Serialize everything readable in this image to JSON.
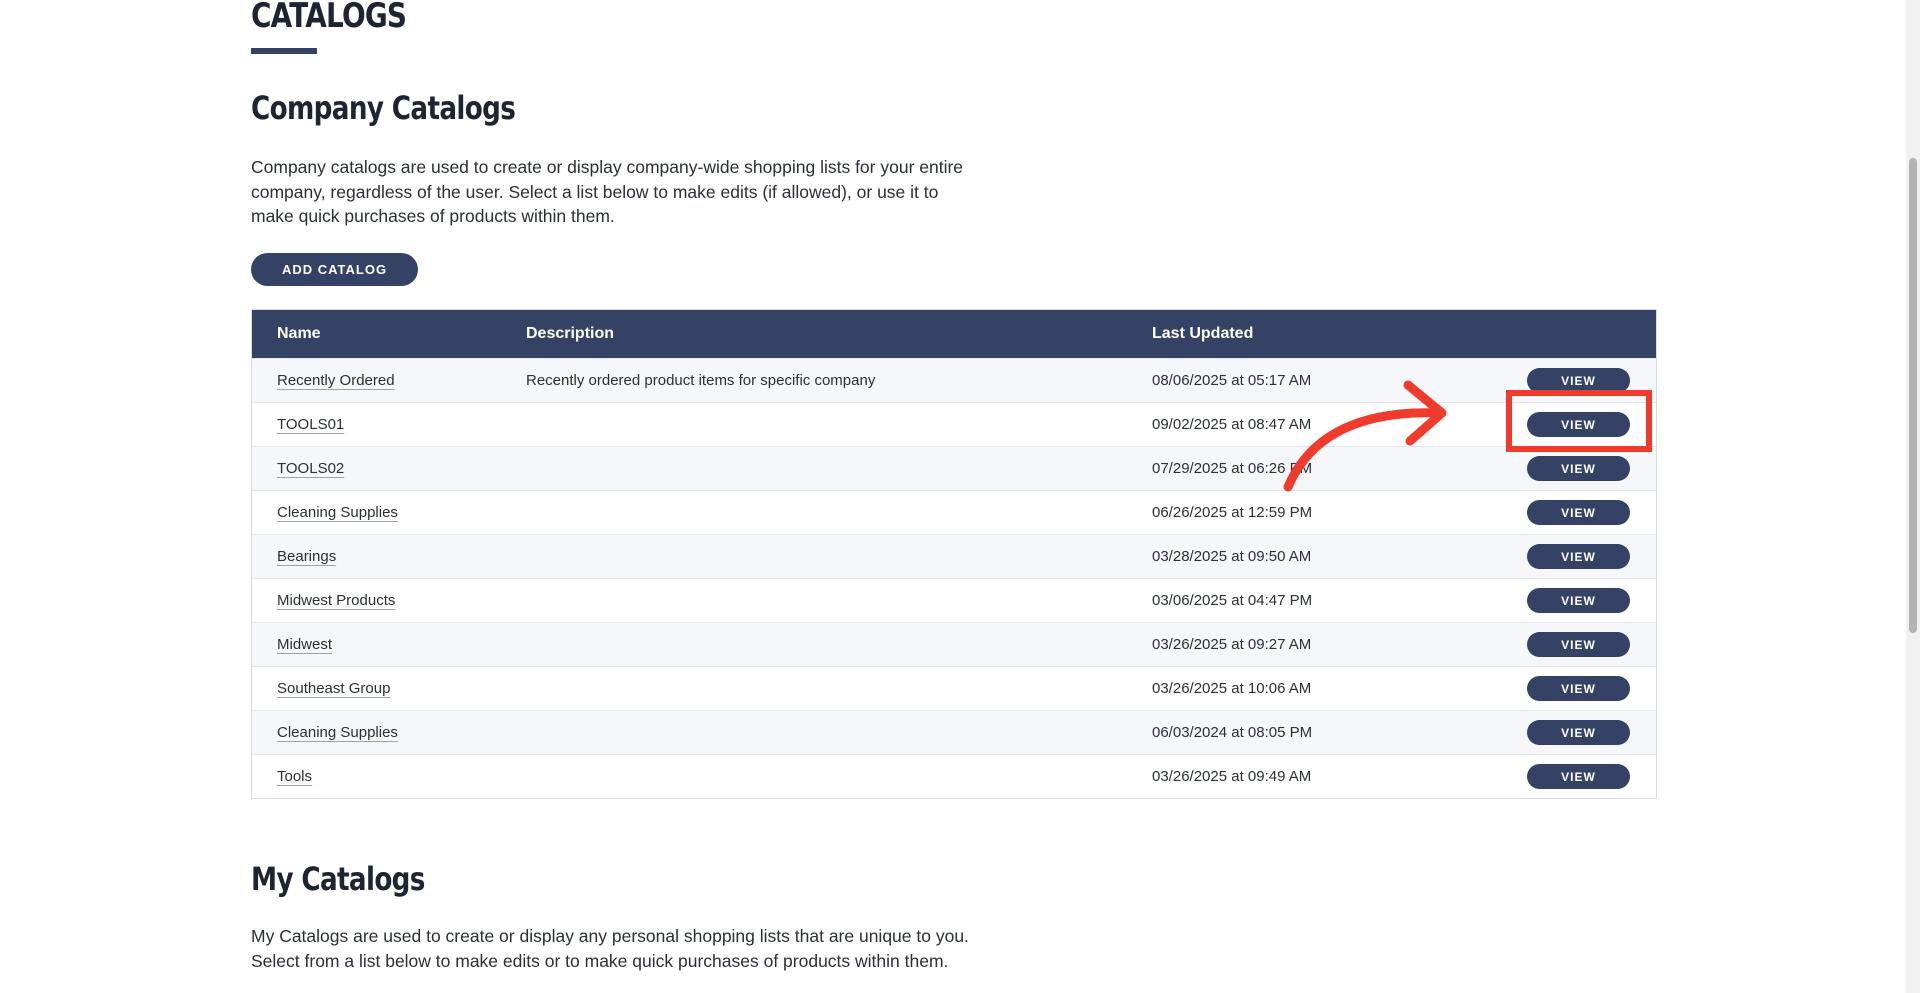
{
  "page": {
    "title": "CATALOGS"
  },
  "company": {
    "heading": "Company Catalogs",
    "description": "Company catalogs are used to create or display company-wide shopping lists for your entire company, regardless of the user. Select a list below to make edits (if allowed), or use it to make quick purchases of products within them.",
    "add_button_label": "ADD CATALOG",
    "table": {
      "columns": {
        "name": "Name",
        "description": "Description",
        "last_updated": "Last Updated"
      },
      "view_label": "VIEW",
      "rows": [
        {
          "name": "Recently Ordered",
          "description": "Recently ordered product items for specific company",
          "last_updated": "08/06/2025 at 05:17 AM"
        },
        {
          "name": "TOOLS01",
          "description": "",
          "last_updated": "09/02/2025 at 08:47 AM"
        },
        {
          "name": "TOOLS02",
          "description": "",
          "last_updated": "07/29/2025 at 06:26 PM"
        },
        {
          "name": "Cleaning Supplies",
          "description": "",
          "last_updated": "06/26/2025 at 12:59 PM"
        },
        {
          "name": "Bearings",
          "description": "",
          "last_updated": "03/28/2025 at 09:50 AM"
        },
        {
          "name": "Midwest Products",
          "description": "",
          "last_updated": "03/06/2025 at 04:47 PM"
        },
        {
          "name": "Midwest",
          "description": "",
          "last_updated": "03/26/2025 at 09:27 AM"
        },
        {
          "name": "Southeast Group",
          "description": "",
          "last_updated": "03/26/2025 at 10:06 AM"
        },
        {
          "name": "Cleaning Supplies",
          "description": "",
          "last_updated": "06/03/2024 at 08:05 PM"
        },
        {
          "name": "Tools",
          "description": "",
          "last_updated": "03/26/2025 at 09:49 AM"
        }
      ]
    }
  },
  "my": {
    "heading": "My Catalogs",
    "description": "My Catalogs are used to create or display any personal shopping lists that are unique to you. Select from a list below to make edits or to make quick purchases of products within them."
  },
  "colors": {
    "primary": "#344266",
    "annotation": "#f03a2c"
  },
  "annotation": {
    "highlighted_row_index": 1,
    "icons": [
      "curved-arrow-icon"
    ]
  }
}
